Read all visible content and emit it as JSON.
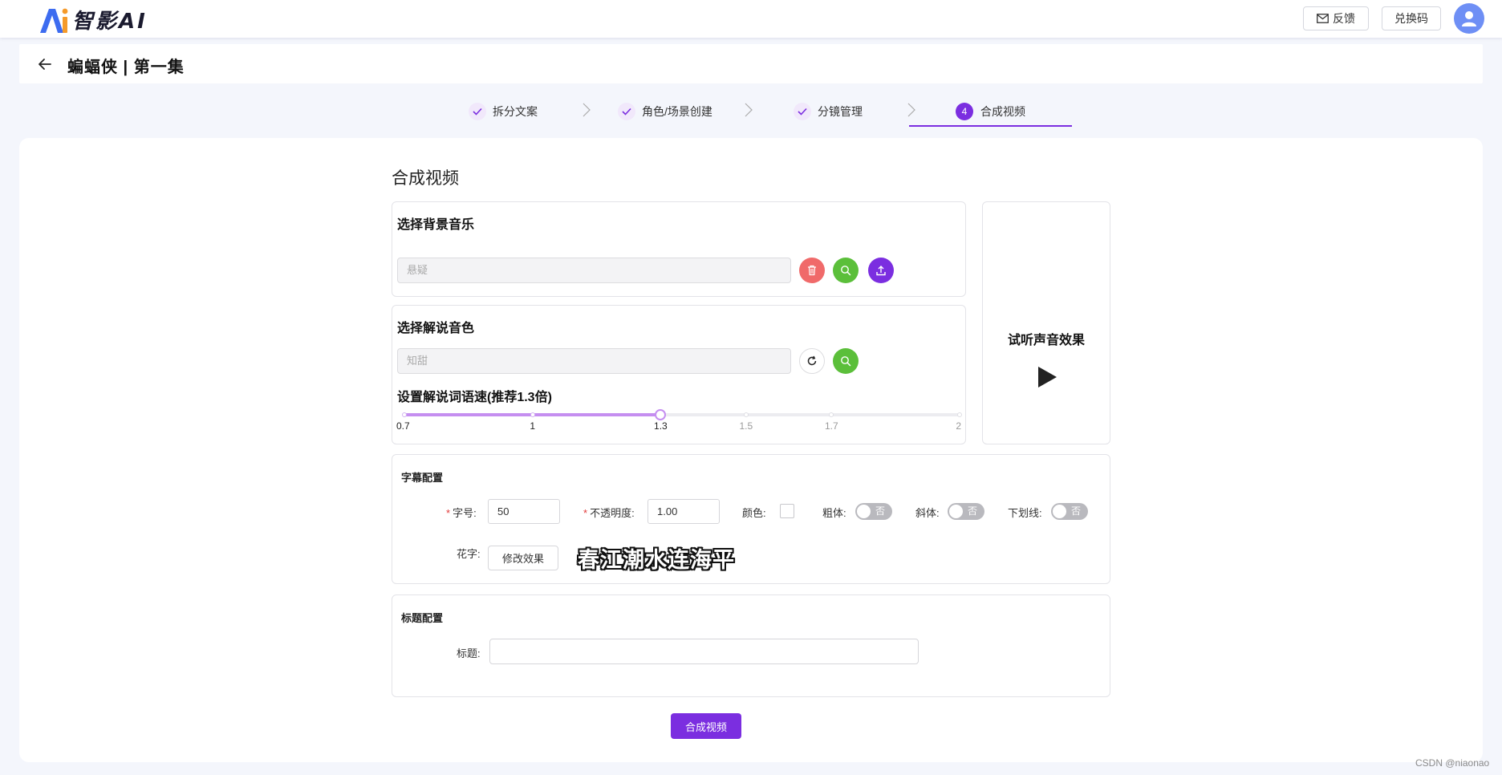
{
  "app": {
    "brand": "智影AI",
    "feedback_label": "反馈",
    "redeem_label": "兑换码"
  },
  "header": {
    "title": "蝙蝠侠 | 第一集"
  },
  "steps": [
    {
      "label": "拆分文案",
      "state": "done"
    },
    {
      "label": "角色/场景创建",
      "state": "done"
    },
    {
      "label": "分镜管理",
      "state": "done"
    },
    {
      "number": "4",
      "label": "合成视频",
      "state": "active"
    }
  ],
  "page": {
    "title": "合成视频"
  },
  "bgm": {
    "title": "选择背景音乐",
    "placeholder": "悬疑"
  },
  "voice": {
    "title": "选择解说音色",
    "placeholder": "知甜"
  },
  "speed": {
    "title": "设置解说词语速(推荐1.3倍)",
    "marks": [
      "0.7",
      "1",
      "1.3",
      "1.5",
      "1.7",
      "2"
    ],
    "min": 0.7,
    "max": 2,
    "value": 1.3
  },
  "listen": {
    "title": "试听声音效果"
  },
  "subtitle": {
    "section_title": "字幕配置",
    "font_size_label": "字号:",
    "font_size_value": "50",
    "opacity_label": "不透明度:",
    "opacity_value": "1.00",
    "color_label": "颜色:",
    "bold_label": "粗体:",
    "italic_label": "斜体:",
    "underline_label": "下划线:",
    "toggle_off_text": "否",
    "fancy_label": "花字:",
    "effect_button": "修改效果",
    "preview_text": "春江潮水连海平"
  },
  "title_config": {
    "section_title": "标题配置",
    "title_label": "标题:",
    "title_value": ""
  },
  "actions": {
    "compose_button": "合成视频"
  },
  "watermark": "CSDN @niaonao",
  "colors": {
    "accent": "#7b2ee0",
    "slider": "#c58ef0",
    "delete": "#f06a6a",
    "search": "#5bbf3a"
  }
}
